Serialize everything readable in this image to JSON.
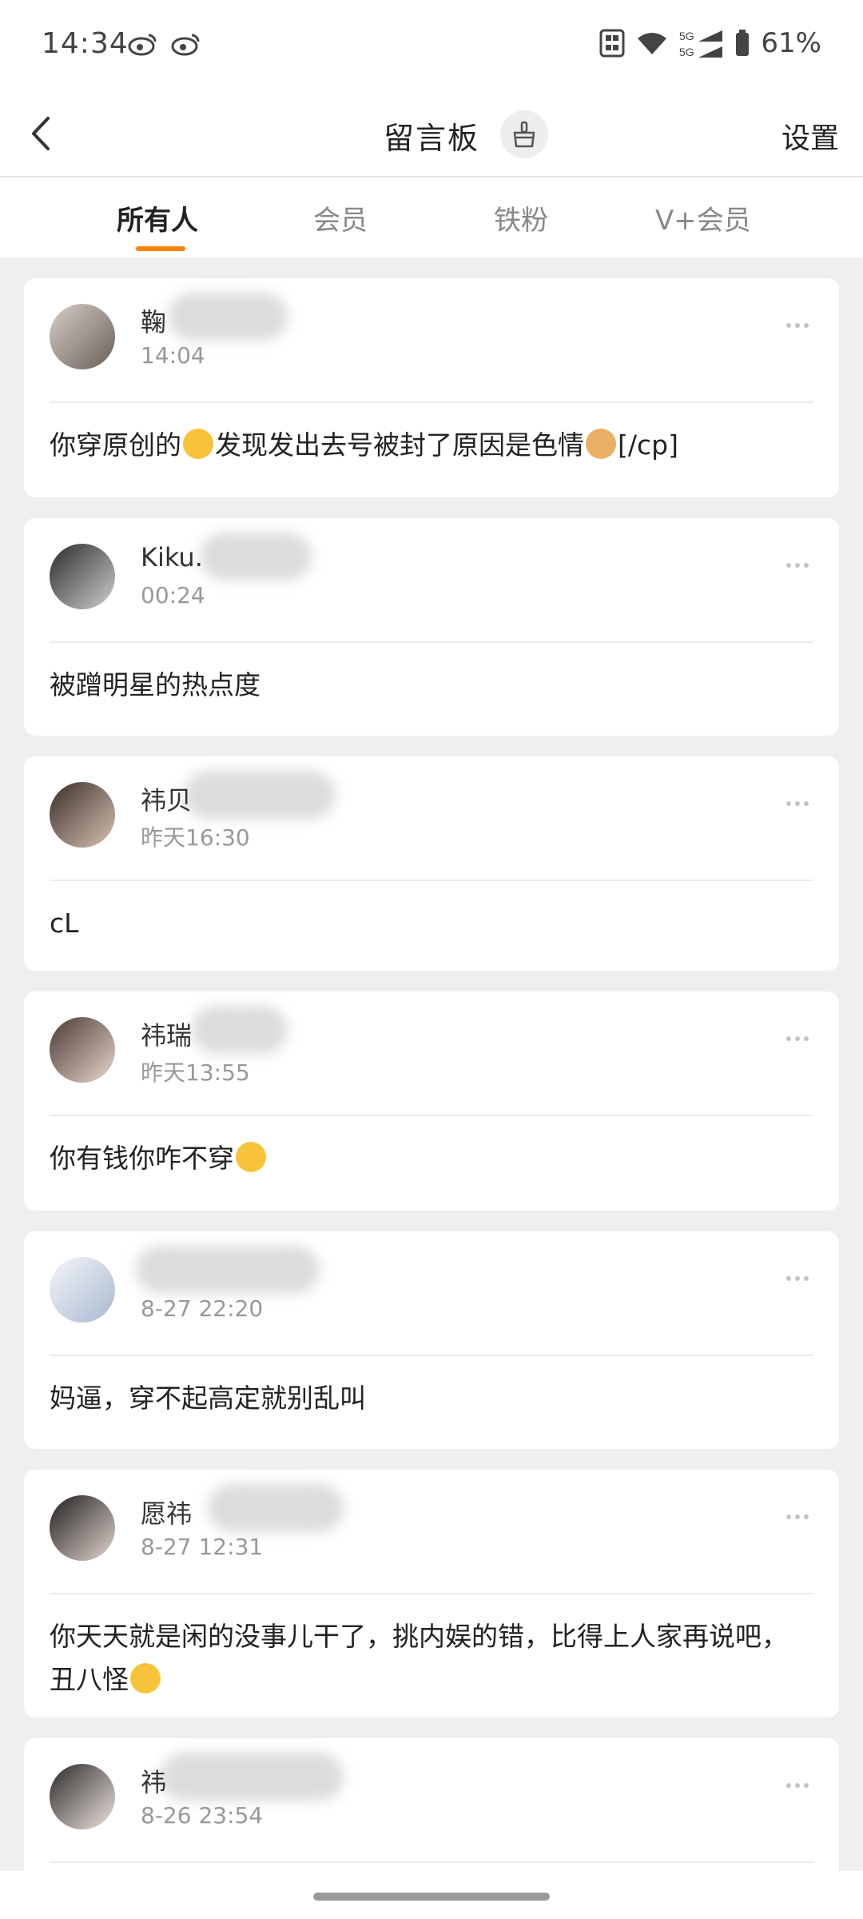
{
  "status_bar": {
    "time": "14:34",
    "battery": "61%",
    "network": "5G"
  },
  "header": {
    "title": "留言板",
    "settings_label": "设置"
  },
  "tabs": [
    {
      "label": "所有人",
      "active": true
    },
    {
      "label": "会员",
      "active": false
    },
    {
      "label": "铁粉",
      "active": false
    },
    {
      "label": "V+会员",
      "active": false
    }
  ],
  "messages": [
    {
      "name": "鞠",
      "time": "14:04",
      "text": "你穿原创的",
      "text2": "发现发出去号被封了原因是色情",
      "text3": "[/cp]"
    },
    {
      "name": "Kiku.",
      "time": "00:24",
      "text": "被蹭明星的热点度"
    },
    {
      "name": "祎贝",
      "time": "昨天16:30",
      "text": "cL"
    },
    {
      "name": "祎瑞",
      "time": "昨天13:55",
      "text": "你有钱你咋不穿"
    },
    {
      "name": "",
      "time": "8-27 22:20",
      "text": "妈逼，穿不起高定就别乱叫"
    },
    {
      "name": "愿祎",
      "time": "8-27 12:31",
      "text": "你天天就是闲的没事儿干了，挑内娱的错，比得上人家再说吧，丑八怪"
    },
    {
      "name": "祎",
      "time": "8-26 23:54",
      "text": ""
    }
  ],
  "colors": {
    "accent": "#ff8200",
    "background": "#efefef",
    "card": "#ffffff"
  }
}
